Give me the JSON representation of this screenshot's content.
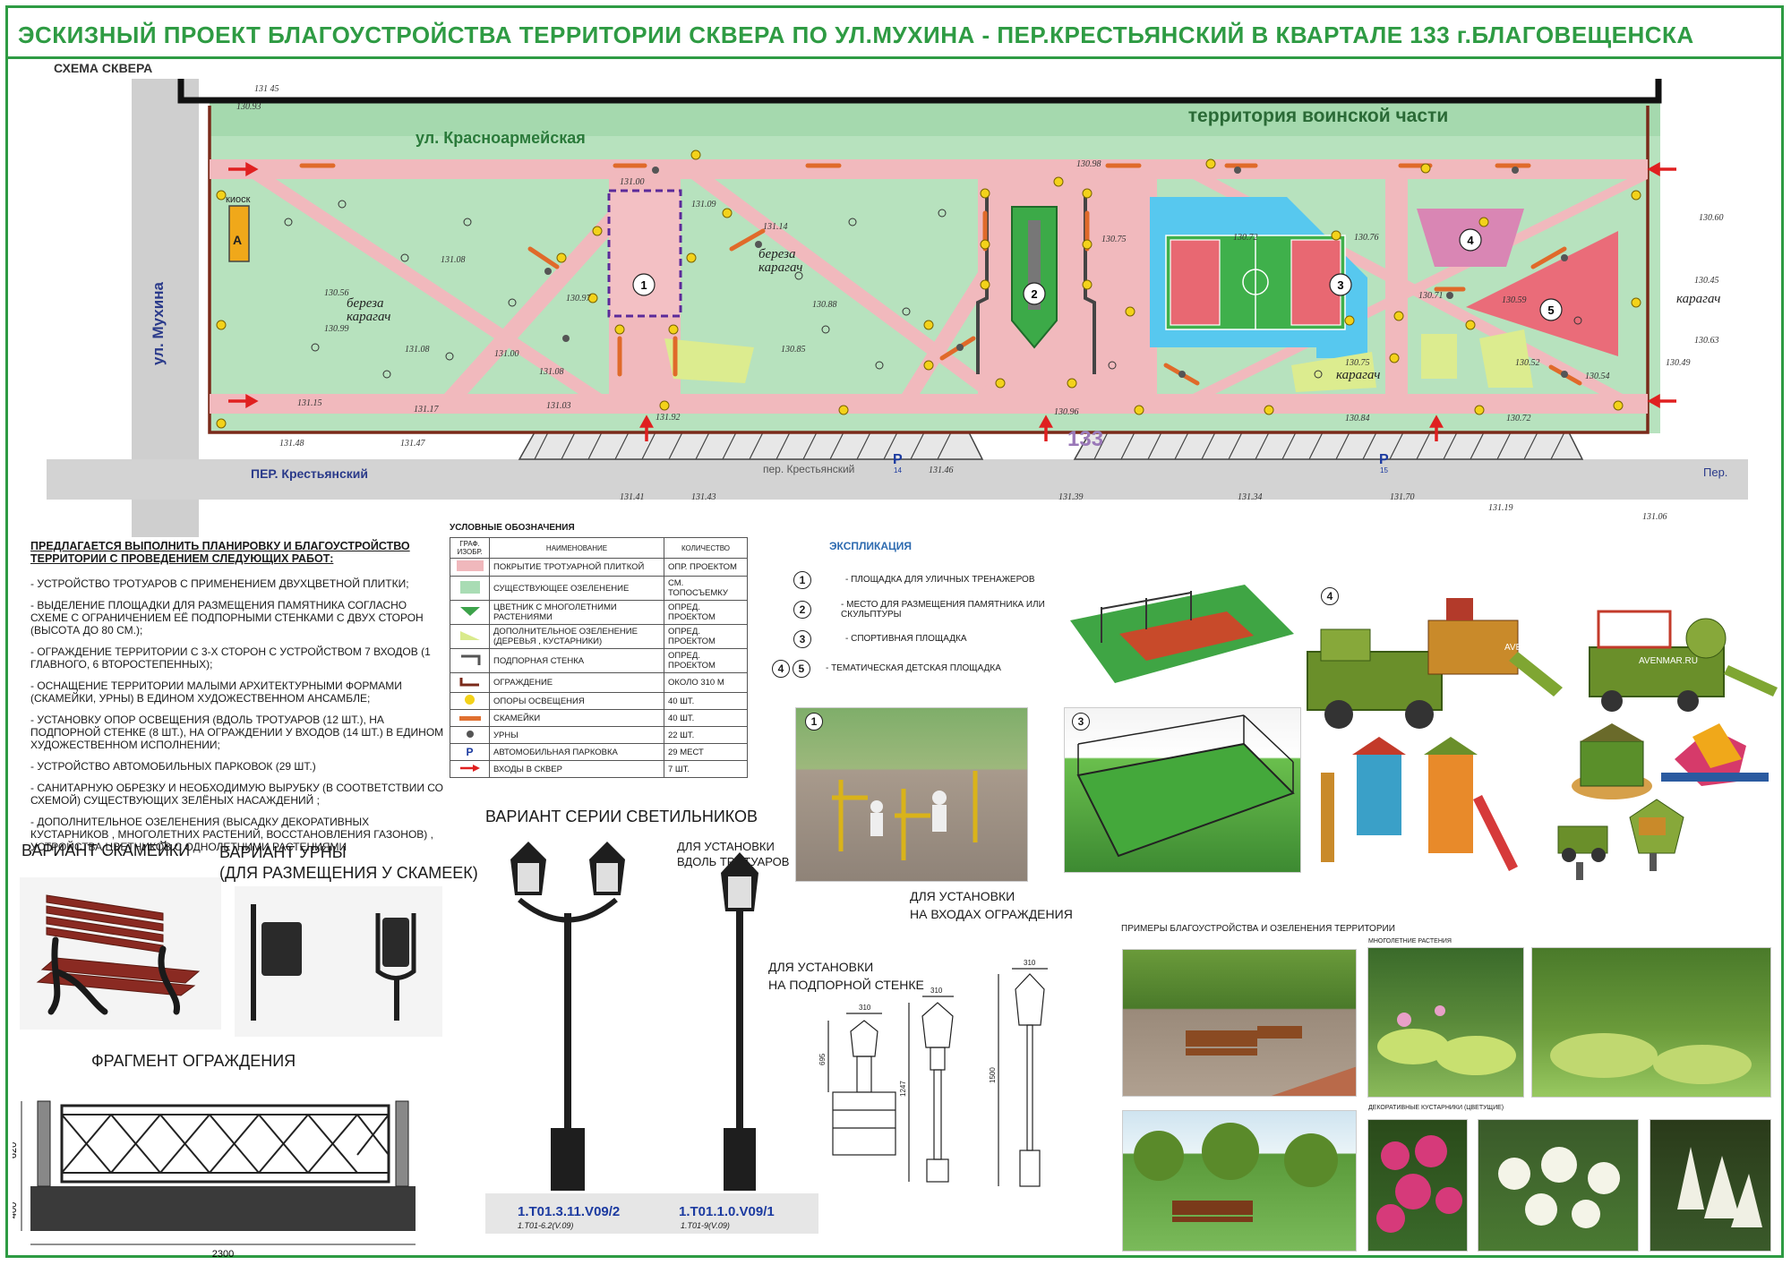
{
  "title": "ЭСКИЗНЫЙ ПРОЕКТ БЛАГОУСТРОЙСТВА   ТЕРРИТОРИИ СКВЕРА ПО УЛ.МУХИНА - ПЕР.КРЕСТЬЯНСКИЙ В  КВАРТАЛЕ  133  г.БЛАГОВЕЩЕНСКА",
  "scheme_label": "СХЕМА  СКВЕРА",
  "map": {
    "military": "территория воинской части",
    "street_krasnoarm": "ул. Красноармейская",
    "street_mukhina": "ул. Мухина",
    "lane_krest": "ПЕР. Крестьянский",
    "lane_krest2": "пер. Крестьянский",
    "kiosk": "киоск",
    "kiosk_letter": "А",
    "quarter": "133",
    "parking1": "P",
    "parking1_num": "14",
    "parking2": "P",
    "parking2_num": "15",
    "pe_label": "Пер.",
    "tree_labels": [
      "береза",
      "карагач",
      "береза",
      "карагач",
      "карагач",
      "карагач"
    ],
    "zones": [
      "1",
      "2",
      "3",
      "4",
      "5"
    ],
    "elevations": [
      "131 45",
      "130.93",
      "131.00",
      "130.97",
      "131.08",
      "130.56",
      "130.99",
      "131.08",
      "131.00",
      "131.15",
      "131.08",
      "131.14",
      "131.09",
      "130.98",
      "130.88",
      "130.85",
      "130.75",
      "130.72",
      "130.76",
      "130.71",
      "130.59",
      "130.49",
      "130.54",
      "130.75",
      "130.52",
      "131.17",
      "131.03",
      "131.92",
      "130.96",
      "130.84",
      "130.72",
      "131.48",
      "131.47",
      "131.46",
      "131.41",
      "131.43",
      "131.39",
      "131.34",
      "131.70",
      "131.19",
      "131.06",
      "130.60",
      "130.63",
      "130.45"
    ]
  },
  "works": {
    "head": "ПРЕДЛАГАЕТСЯ  ВЫПОЛНИТЬ  ПЛАНИРОВКУ  И  БЛАГОУСТРОЙСТВО ТЕРРИТОРИИ  С ПРОВЕДЕНИЕМ СЛЕДУЮЩИХ РАБОТ:",
    "items": [
      "- УСТРОЙСТВО ТРОТУАРОВ С ПРИМЕНЕНИЕМ  ДВУХЦВЕТНОЙ ПЛИТКИ;",
      "- ВЫДЕЛЕНИЕ ПЛОЩАДКИ ДЛЯ РАЗМЕЩЕНИЯ ПАМЯТНИКА  СОГЛАСНО СХЕМЕ С ОГРАНИЧЕНИЕМ ЕЁ ПОДПОРНЫМИ СТЕНКАМИ С ДВУХ СТОРОН (ВЫСОТА ДО 80 СМ.);",
      "- ОГРАЖДЕНИЕ ТЕРРИТОРИИ С 3-Х СТОРОН С  УСТРОЙСТВОМ 7 ВХОДОВ (1 ГЛАВНОГО, 6 ВТОРОСТЕПЕННЫХ);",
      "- ОСНАЩЕНИЕ ТЕРРИТОРИИ МАЛЫМИ АРХИТЕКТУРНЫМИ ФОРМАМИ (СКАМЕЙКИ,  УРНЫ)   В ЕДИНОМ  ХУДОЖЕСТВЕННОМ АНСАМБЛЕ;",
      "- УСТАНОВКУ  ОПОР ОСВЕЩЕНИЯ (ВДОЛЬ ТРОТУАРОВ (12 ШТ.), НА ПОДПОРНОЙ СТЕНКЕ (8 ШТ.), НА ОГРАЖДЕНИИ У ВХОДОВ (14 ШТ.) В ЕДИНОМ ХУДОЖЕСТВЕННОМ  ИСПОЛНЕНИИ;",
      "- УСТРОЙСТВО АВТОМОБИЛЬНЫХ ПАРКОВОК  (29 ШТ.)",
      "-  САНИТАРНУЮ ОБРЕЗКУ  И НЕОБХОДИМУЮ ВЫРУБКУ (В СООТВЕТСТВИИ СО СХЕМОЙ) СУЩЕСТВУЮЩИХ ЗЕЛЁНЫХ НАСАЖДЕНИЙ ;",
      "-  ДОПОЛНИТЕЛЬНОЕ ОЗЕЛЕНЕНИЯ (ВЫСАДКУ ДЕКОРАТИВНЫХ КУСТАРНИКОВ , МНОГОЛЕТНИХ РАСТЕНИЙ, ВОССТАНОВЛЕНИЯ ГАЗОНОВ) ,   УСТРОЙСТВА ЦВЕТНИКОВ С ОДНОЛЕТНИМИ РАСТЕНИЯМИ"
    ]
  },
  "legend": {
    "title": "УСЛОВНЫЕ ОБОЗНАЧЕНИЯ",
    "col_sym": "ГРАФ. ИЗОБР.",
    "col_name": "НАИМЕНОВАНИЕ",
    "col_qty": "КОЛИЧЕСТВО",
    "rows": [
      {
        "name": "ПОКРЫТИЕ ТРОТУАРНОЙ ПЛИТКОЙ",
        "qty": "ОПР. ПРОЕКТОМ",
        "color": "#f0b8bc"
      },
      {
        "name": "СУЩЕСТВУЮЩЕЕ  ОЗЕЛЕНЕНИЕ",
        "qty": "СМ. ТОПОСЪЕМКУ",
        "color": "#a9dcb4"
      },
      {
        "name": "ЦВЕТНИК С МНОГОЛЕТНИМИ РАСТЕНИЯМИ",
        "qty": "ОПРЕД. ПРОЕКТОМ",
        "color": "#3ca24a"
      },
      {
        "name": "ДОПОЛНИТЕЛЬНОЕ  ОЗЕЛЕНЕНИЕ (ДЕРЕВЬЯ , КУСТАРНИКИ)",
        "qty": "ОПРЕД. ПРОЕКТОМ",
        "color": "#d9ea8c"
      },
      {
        "name": "ПОДПОРНАЯ СТЕНКА",
        "qty": "ОПРЕД. ПРОЕКТОМ",
        "color": "#555555"
      },
      {
        "name": "ОГРАЖДЕНИЕ",
        "qty": "ОКОЛО 310 М",
        "color": "#7a2a1a"
      },
      {
        "name": "ОПОРЫ ОСВЕЩЕНИЯ",
        "qty": "40 ШТ.",
        "color": "#f3d21a"
      },
      {
        "name": "СКАМЕЙКИ",
        "qty": "40 ШТ.",
        "color": "#e07030"
      },
      {
        "name": "УРНЫ",
        "qty": "22 ШТ.",
        "color": "#555555"
      },
      {
        "name": "АВТОМОБИЛЬНАЯ ПАРКОВКА",
        "qty": "29 МЕСТ",
        "color": "#1b3aa0"
      },
      {
        "name": "ВХОДЫ В  СКВЕР",
        "qty": "7 ШТ.",
        "color": "#e02020"
      }
    ]
  },
  "explication": {
    "title": "ЭКСПЛИКАЦИЯ",
    "items": [
      {
        "num": "1",
        "text": "- ПЛОЩАДКА ДЛЯ УЛИЧНЫХ ТРЕНАЖЕРОВ"
      },
      {
        "num": "2",
        "text": "- МЕСТО ДЛЯ РАЗМЕЩЕНИЯ  ПАМЯТНИКА ИЛИ СКУЛЬПТУРЫ"
      },
      {
        "num": "3",
        "text": "- СПОРТИВНАЯ ПЛОЩАДКА"
      },
      {
        "num": "4",
        "num2": "5",
        "text": "- ТЕМАТИЧЕСКАЯ ДЕТСКАЯ  ПЛОЩАДКА"
      }
    ]
  },
  "photo_numbers": {
    "p1": "1",
    "p3": "3",
    "p4": "4"
  },
  "watermark": "AVENMAR.RU",
  "bench_caption": "ВАРИАНТ СКАМЕЙКИ",
  "urn_caption1": "ВАРИАНТ УРНЫ",
  "urn_caption2": "(ДЛЯ РАЗМЕЩЕНИЯ У СКАМЕЕК)",
  "fence_caption": "ФРАГМЕНТ  ОГРАЖДЕНИЯ",
  "fence_dims": {
    "h1": "620",
    "h2": "400",
    "w": "2300"
  },
  "lamps": {
    "caption": "ВАРИАНТ  СЕРИИ  СВЕТИЛЬНИКОВ",
    "sidewalk_caption1": "ДЛЯ УСТАНОВКИ",
    "sidewalk_caption2": "ВДОЛЬ ТРОТУАРОВ",
    "entrance_caption1": "ДЛЯ УСТАНОВКИ",
    "entrance_caption2": "НА ВХОДАХ ОГРАЖДЕНИЯ",
    "wall_caption1": "ДЛЯ УСТАНОВКИ",
    "wall_caption2": "НА ПОДПОРНОЙ СТЕНКЕ",
    "model1": "1.Т01.3.11.V09/2",
    "model1_sub": "1.T01-6.2(V.09)",
    "model2": "1.Т01.1.0.V09/1",
    "model2_sub": "1.T01-9(V.09)",
    "dim_310a": "310",
    "dim_695": "695",
    "dim_310b": "310",
    "dim_1247": "1247",
    "dim_310c": "310",
    "dim_1500": "1500"
  },
  "examples": {
    "title": "ПРИМЕРЫ  БЛАГОУСТРОЙСТВА И ОЗЕЛЕНЕНИЯ ТЕРРИТОРИИ",
    "perennials": "МНОГОЛЕТНИЕ РАСТЕНИЯ",
    "shrubs": "ДЕКОРАТИВНЫЕ  КУСТАРНИКИ (ЦВЕТУЩИЕ)"
  }
}
